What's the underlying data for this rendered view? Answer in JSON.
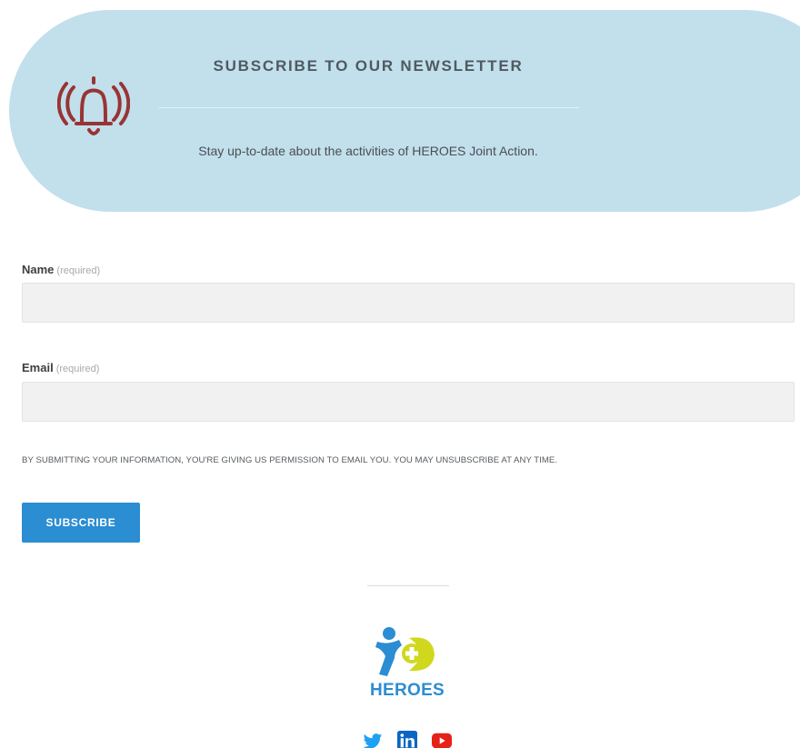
{
  "banner": {
    "title": "SUBSCRIBE TO OUR NEWSLETTER",
    "description": "Stay up-to-date about the activities of HEROES Joint Action.",
    "icon": "bell-ringing-icon",
    "background_color": "#c2dfec",
    "icon_color": "#993434"
  },
  "form": {
    "name_label": "Name",
    "name_required": "(required)",
    "name_value": "",
    "email_label": "Email",
    "email_required": "(required)",
    "email_value": "",
    "consent_text": "BY SUBMITTING YOUR INFORMATION, YOU'RE GIVING US PERMISSION TO EMAIL YOU. YOU MAY UNSUBSCRIBE AT ANY TIME.",
    "submit_label": "SUBSCRIBE",
    "submit_color": "#2b8dd2"
  },
  "footer": {
    "logo_text": "HEROES",
    "social": [
      {
        "name": "twitter-icon",
        "color": "#1da1f2"
      },
      {
        "name": "linkedin-icon",
        "color": "#0a66c2"
      },
      {
        "name": "youtube-icon",
        "color": "#e62117"
      }
    ]
  }
}
